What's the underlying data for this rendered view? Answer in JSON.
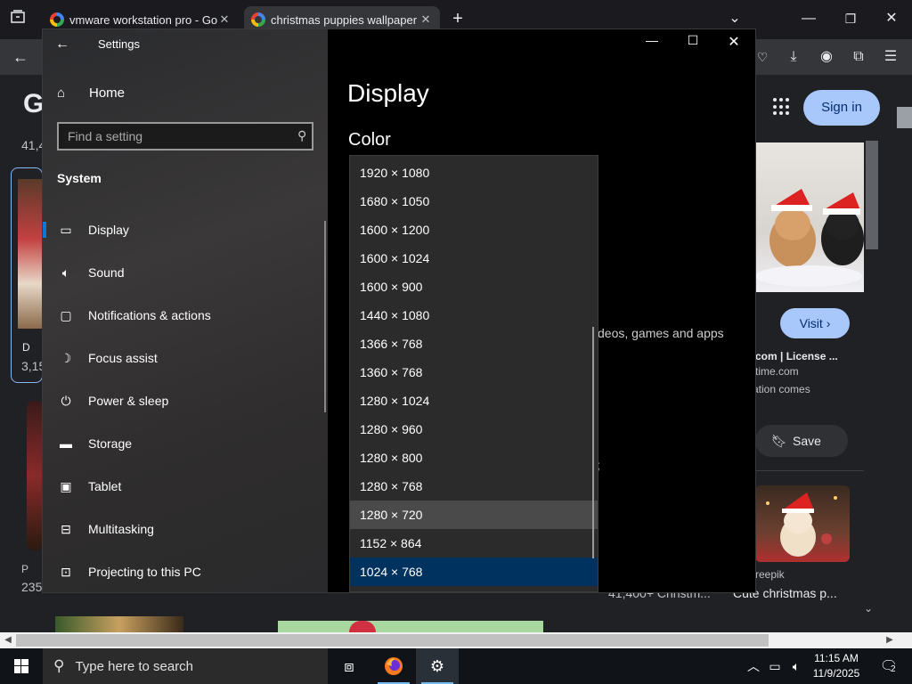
{
  "browser": {
    "tabs": [
      {
        "title": "vmware workstation pro - Goog",
        "active": false
      },
      {
        "title": "christmas puppies wallpaper - G",
        "active": true
      }
    ],
    "new_tab": "+",
    "sign_in": "Sign in",
    "google_partial": "G",
    "results_count_partial": "41,4",
    "left_card": {
      "source_partial": "D",
      "count_partial": "3,15"
    },
    "left_card2": {
      "source_partial": "P",
      "count_partial": "235"
    },
    "preview": {
      "visit": "Visit",
      "source": "e.com | License ...",
      "domain": "time.com",
      "desc": "ation comes",
      "save": "Save"
    },
    "related": [
      {
        "source": "reepik",
        "title": "Cute christmas p..."
      },
      {
        "title": "41,400+ Christm..."
      }
    ]
  },
  "settings": {
    "window_title": "Settings",
    "home": "Home",
    "search_placeholder": "Find a setting",
    "section": "System",
    "nav": [
      {
        "label": "Display",
        "icon": "monitor-icon",
        "selected": true
      },
      {
        "label": "Sound",
        "icon": "speaker-icon",
        "selected": false
      },
      {
        "label": "Notifications & actions",
        "icon": "notification-icon",
        "selected": false
      },
      {
        "label": "Focus assist",
        "icon": "moon-icon",
        "selected": false
      },
      {
        "label": "Power & sleep",
        "icon": "power-icon",
        "selected": false
      },
      {
        "label": "Storage",
        "icon": "storage-icon",
        "selected": false
      },
      {
        "label": "Tablet",
        "icon": "tablet-icon",
        "selected": false
      },
      {
        "label": "Multitasking",
        "icon": "multitasking-icon",
        "selected": false
      },
      {
        "label": "Projecting to this PC",
        "icon": "projecting-icon",
        "selected": false
      }
    ],
    "page_title": "Display",
    "section_color": "Color",
    "partial_text": "deos, games and apps",
    "partial_semicolon": ";",
    "resolutions": [
      "1920 × 1080",
      "1680 × 1050",
      "1600 × 1200",
      "1600 × 1024",
      "1600 × 900",
      "1440 × 1080",
      "1366 × 768",
      "1360 × 768",
      "1280 × 1024",
      "1280 × 960",
      "1280 × 800",
      "1280 × 768",
      "1280 × 720",
      "1152 × 864",
      "1024 × 768"
    ],
    "hovered_resolution": "1280 × 720",
    "selected_resolution": "1024 × 768"
  },
  "taskbar": {
    "search_placeholder": "Type here to search",
    "time": "11:15 AM",
    "date": "11/9/2025",
    "notification_count": "2"
  },
  "colors": {
    "accent": "#0a78d4",
    "selected_item": "#00325f",
    "signin_button": "#a8c7fa"
  }
}
